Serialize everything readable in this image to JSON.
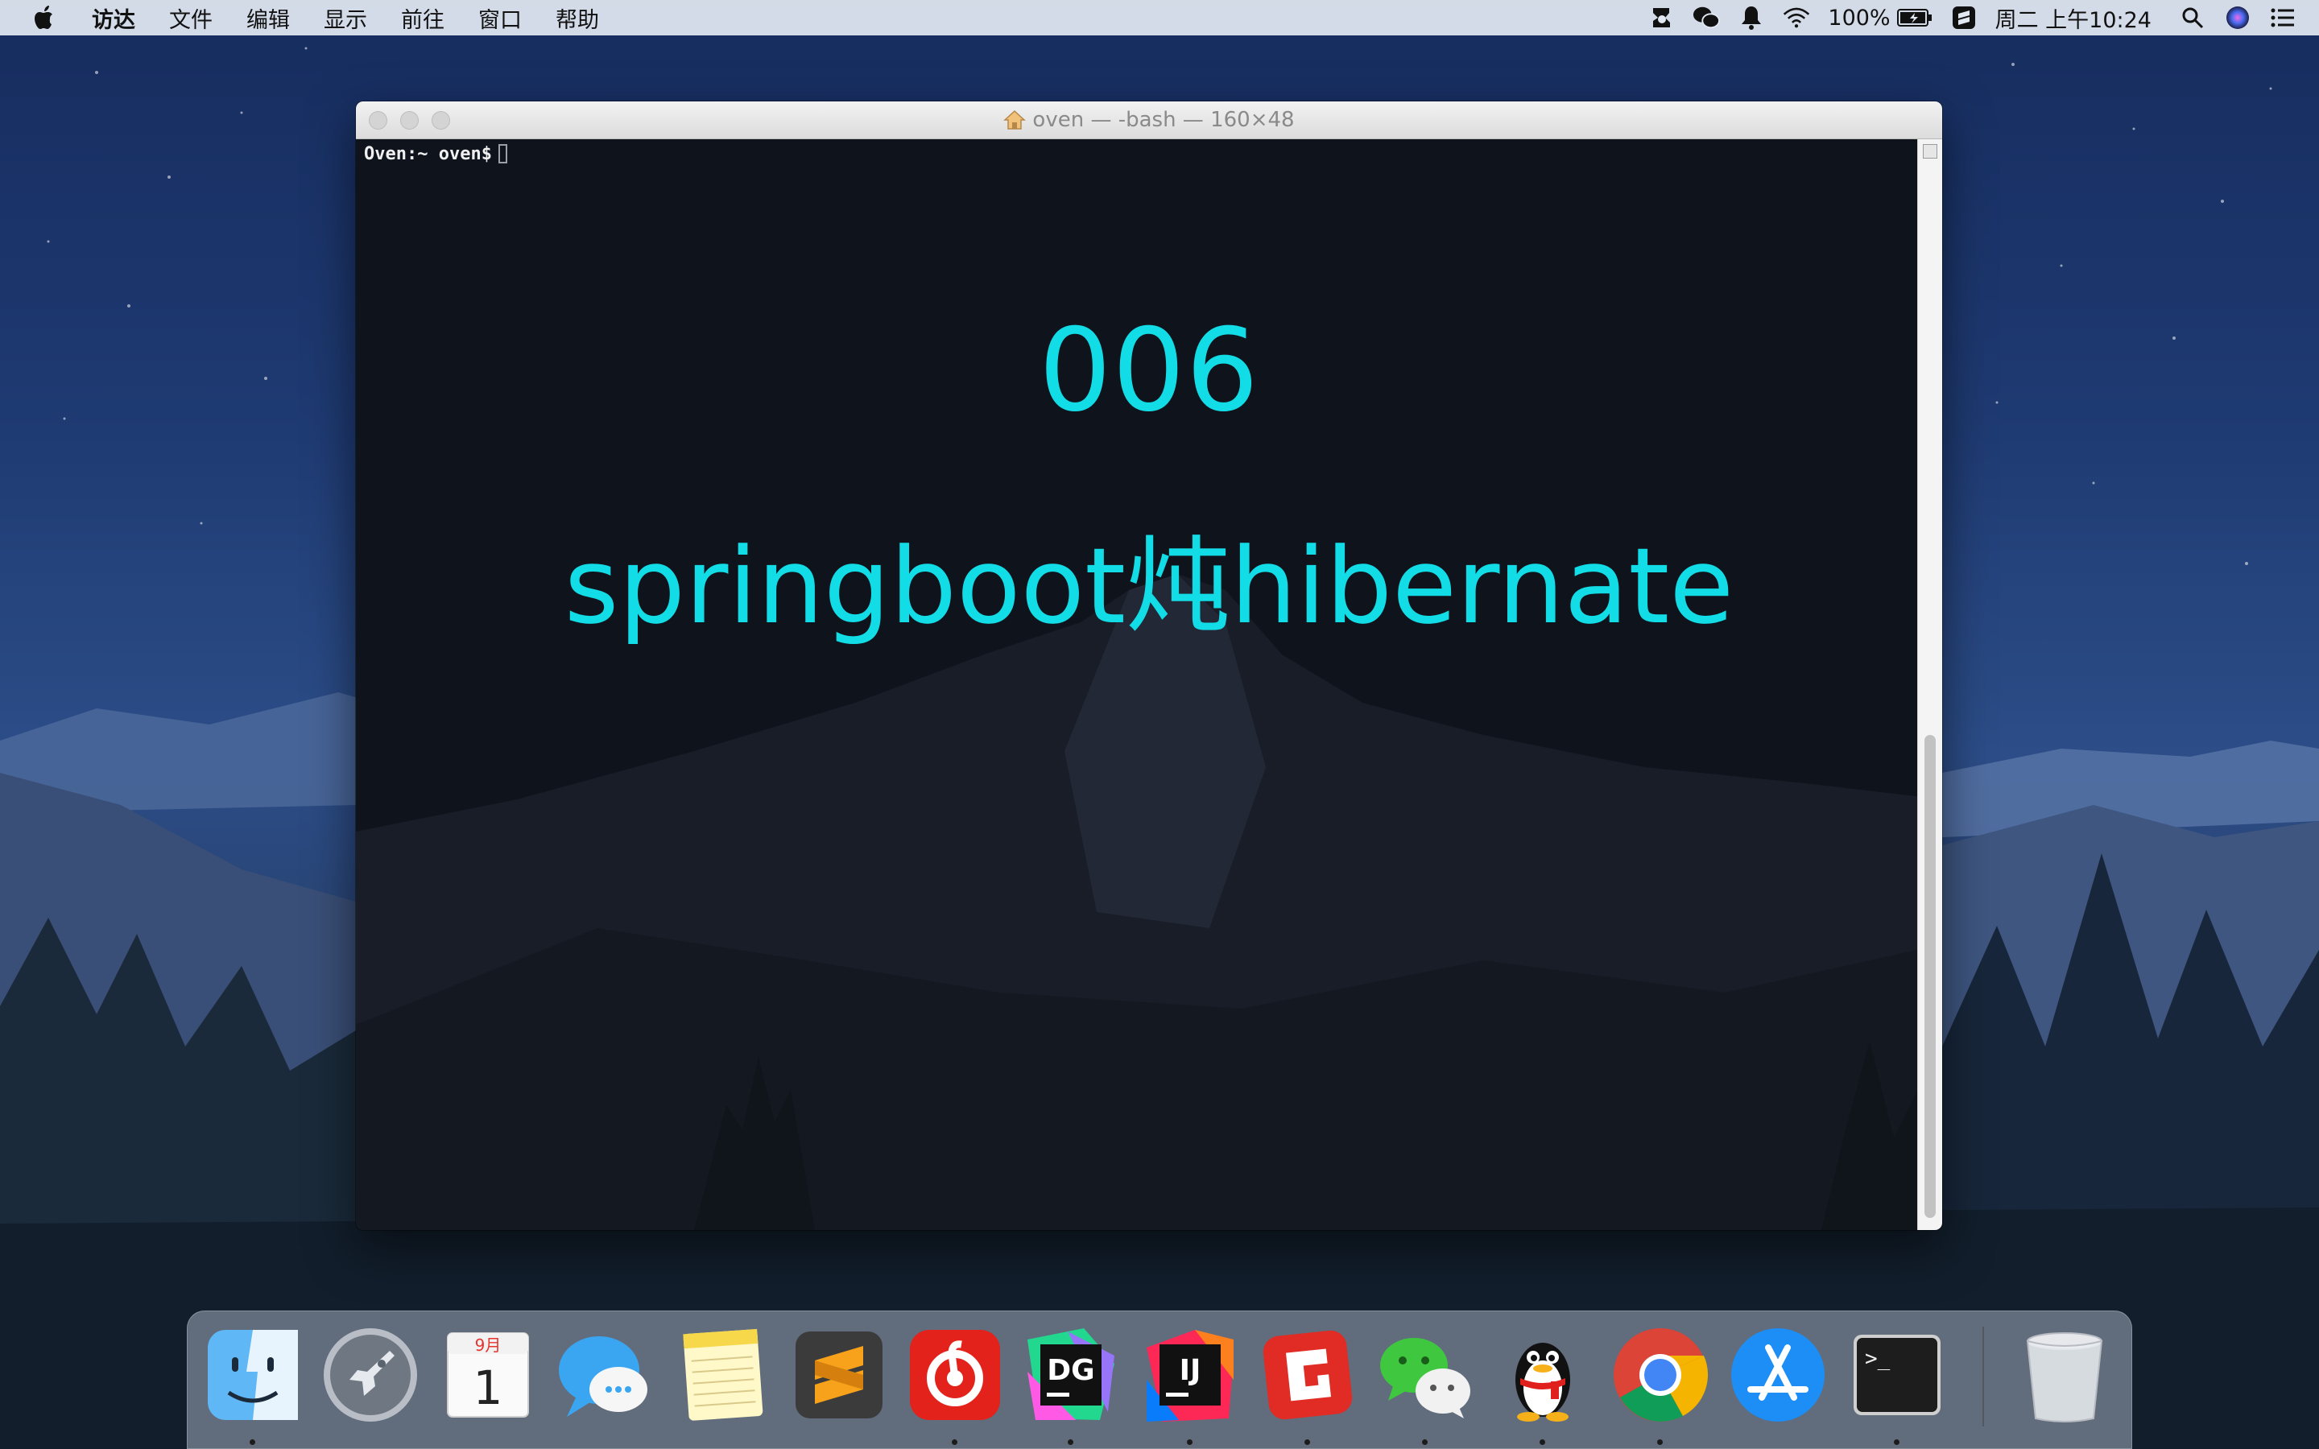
{
  "menubar": {
    "menus": [
      "访达",
      "文件",
      "编辑",
      "显示",
      "前往",
      "窗口",
      "帮助"
    ],
    "battery": "100%",
    "clock": "周二 上午10:24"
  },
  "terminal": {
    "title": "oven — -bash — 160×48",
    "prompt": "Oven:~ oven$",
    "overlay_code": "006",
    "overlay_title": "springboot炖hibernate"
  },
  "dock": {
    "calendar_month": "9月",
    "calendar_day": "1",
    "datagrip_label": "DG",
    "intellij_label": "IJ",
    "terminal_glyph": ">_",
    "apps": [
      "finder-icon",
      "launchpad-icon",
      "calendar-icon",
      "messages-icon",
      "notes-icon",
      "sublime-text-icon",
      "netease-music-icon",
      "datagrip-icon",
      "intellij-idea-icon",
      "gitify-icon",
      "wechat-icon",
      "qq-icon",
      "chrome-icon",
      "app-store-icon",
      "terminal-icon",
      "trash-icon"
    ]
  },
  "colors": {
    "overlay_text": "#12dce6",
    "terminal_bg": "#0f131c",
    "menubar_bg": "#e2e8f2"
  }
}
